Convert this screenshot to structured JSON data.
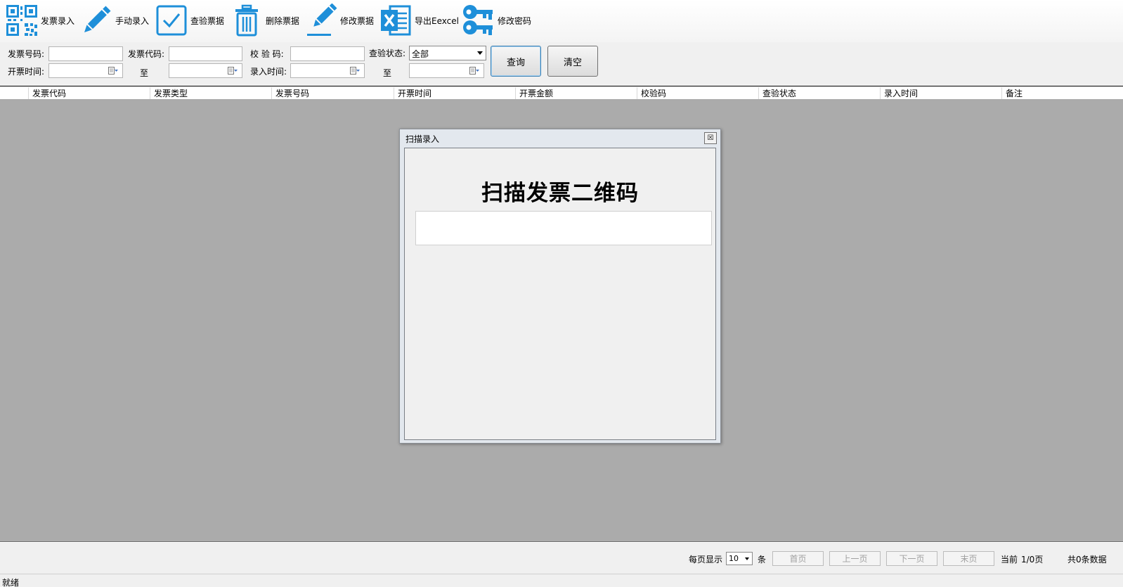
{
  "toolbar": {
    "buttons": [
      {
        "label": "发票录入",
        "icon": "qr-code-icon"
      },
      {
        "label": "手动录入",
        "icon": "pencil-icon"
      },
      {
        "label": "查验票据",
        "icon": "checkbox-check-icon"
      },
      {
        "label": "删除票据",
        "icon": "trash-icon"
      },
      {
        "label": "修改票据",
        "icon": "pencil-underline-icon"
      },
      {
        "label": "导出Eexcel",
        "icon": "excel-icon"
      },
      {
        "label": "修改密码",
        "icon": "keys-icon"
      }
    ]
  },
  "filters": {
    "invoice_number_label": "发票号码:",
    "invoice_code_label": "发票代码:",
    "check_code_label": "校 验 码:",
    "check_status_label": "查验状态:",
    "check_status_value": "全部",
    "issue_time_label": "开票时间:",
    "to_label_1": "至",
    "entry_time_label": "录入时间:",
    "to_label_2": "至",
    "query_button": "查询",
    "clear_button": "清空"
  },
  "grid": {
    "columns": [
      "发票代码",
      "发票类型",
      "发票号码",
      "开票时间",
      "开票金额",
      "校验码",
      "查验状态",
      "录入时间",
      "备注"
    ]
  },
  "dialog": {
    "title": "扫描录入",
    "close_glyph": "☒",
    "heading": "扫描发票二维码"
  },
  "pager": {
    "per_page_label": "每页显示",
    "per_page_value": "10",
    "per_page_unit": "条",
    "first": "首页",
    "prev": "上一页",
    "next": "下一页",
    "last": "末页",
    "current_label": "当前",
    "current_value": "1/0页",
    "total": "共0条数据"
  },
  "status": {
    "text": "就绪"
  },
  "colors": {
    "icon_blue": "#1e8fd9",
    "grid_background": "#ababab"
  }
}
